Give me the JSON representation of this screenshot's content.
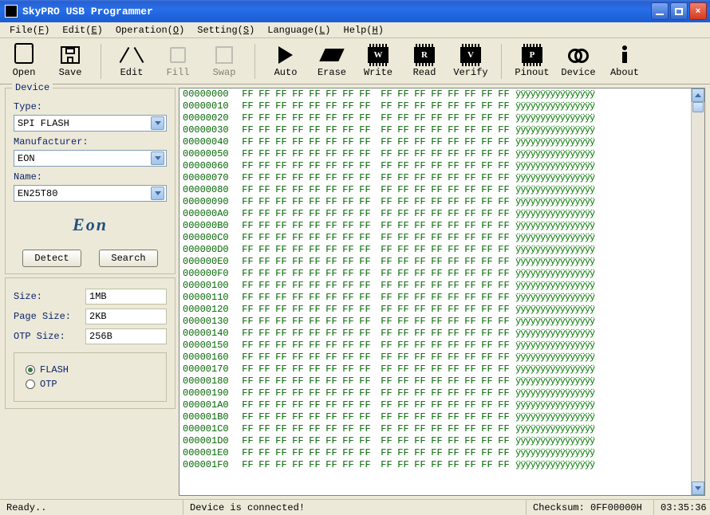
{
  "window": {
    "title": "SkyPRO USB Programmer"
  },
  "menu": {
    "items": [
      {
        "label": "File",
        "u": "F"
      },
      {
        "label": "Edit",
        "u": "E"
      },
      {
        "label": "Operation",
        "u": "O"
      },
      {
        "label": "Setting",
        "u": "S"
      },
      {
        "label": "Language",
        "u": "L"
      },
      {
        "label": "Help",
        "u": "H"
      }
    ]
  },
  "toolbar": {
    "open": "Open",
    "save": "Save",
    "edit": "Edit",
    "fill": "Fill",
    "swap": "Swap",
    "auto": "Auto",
    "erase": "Erase",
    "write": "Write",
    "read": "Read",
    "verify": "Verify",
    "pinout": "Pinout",
    "device": "Device",
    "about": "About",
    "chip_w": "W",
    "chip_r": "R",
    "chip_v": "V",
    "chip_p": "P"
  },
  "device": {
    "legend": "Device",
    "type_label": "Type:",
    "type_value": "SPI FLASH",
    "mfr_label": "Manufacturer:",
    "mfr_value": "EON",
    "name_label": "Name:",
    "name_value": "EN25T80",
    "logo": "Eon",
    "detect": "Detect",
    "search": "Search"
  },
  "info": {
    "size_label": "Size:",
    "size_value": "1MB",
    "page_label": "Page Size:",
    "page_value": "2KB",
    "otp_label": "OTP Size:",
    "otp_value": "256B",
    "radio_flash": "FLASH",
    "radio_otp": "OTP"
  },
  "hex": {
    "byte": "FF",
    "ascii_row": "ÿÿÿÿÿÿÿÿÿÿÿÿÿÿÿÿ",
    "addresses": [
      "00000000",
      "00000010",
      "00000020",
      "00000030",
      "00000040",
      "00000050",
      "00000060",
      "00000070",
      "00000080",
      "00000090",
      "000000A0",
      "000000B0",
      "000000C0",
      "000000D0",
      "000000E0",
      "000000F0",
      "00000100",
      "00000110",
      "00000120",
      "00000130",
      "00000140",
      "00000150",
      "00000160",
      "00000170",
      "00000180",
      "00000190",
      "000001A0",
      "000001B0",
      "000001C0",
      "000001D0",
      "000001E0",
      "000001F0"
    ]
  },
  "status": {
    "ready": "Ready..",
    "conn": "Device is connected!",
    "checksum": "Checksum: 0FF00000H",
    "time": "03:35:36"
  }
}
